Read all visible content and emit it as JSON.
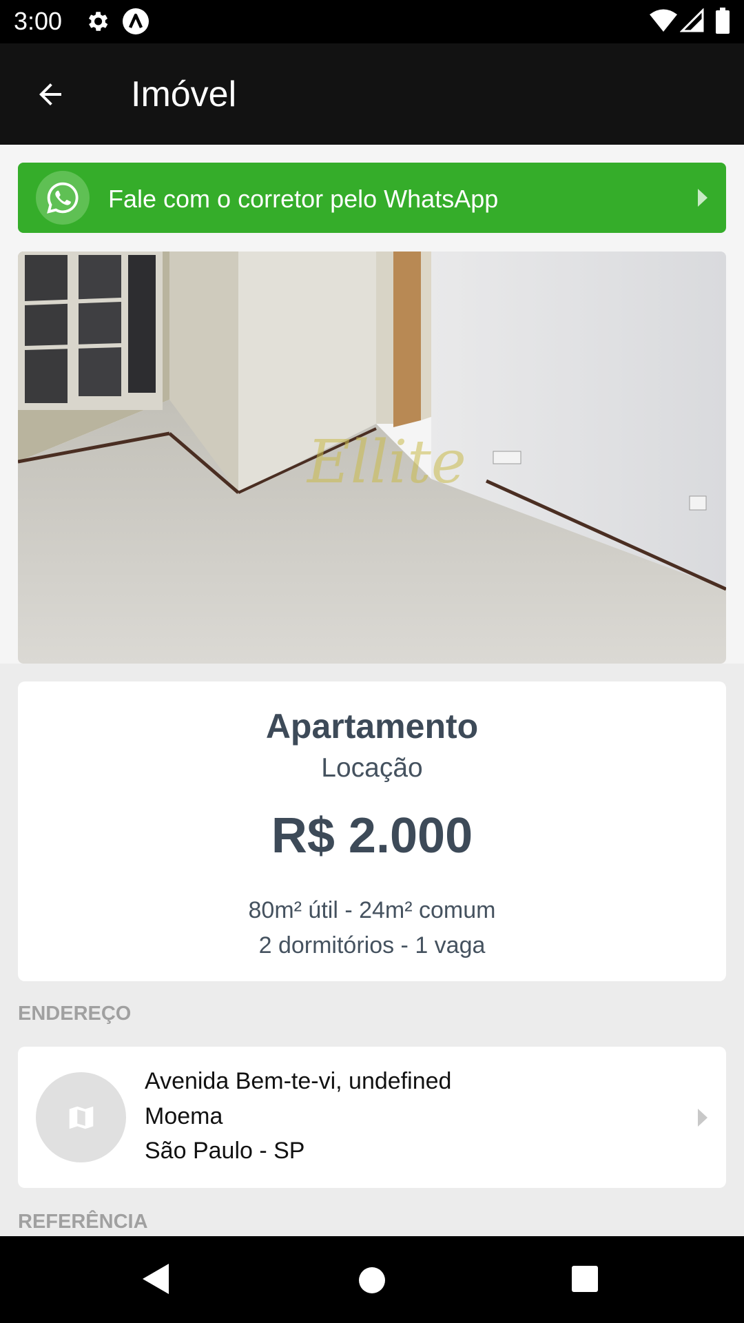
{
  "status_bar": {
    "time": "3:00",
    "icons": [
      "gear-icon",
      "app-a-icon",
      "wifi-icon",
      "signal-icon",
      "battery-icon"
    ]
  },
  "app_bar": {
    "title": "Imóvel",
    "back_icon": "arrow-back-icon"
  },
  "whatsapp": {
    "label": "Fale com o corretor pelo WhatsApp",
    "icon": "whatsapp-icon",
    "color": "#35ad2a"
  },
  "photo": {
    "watermark": "Ellite",
    "alt": "property-photo"
  },
  "property": {
    "type": "Apartamento",
    "purpose": "Locação",
    "price": "R$ 2.000",
    "area": "80m² útil - 24m² comum",
    "rooms": "2 dormitórios - 1 vaga"
  },
  "address_section": {
    "label": "ENDEREÇO",
    "line1": "Avenida Bem-te-vi, undefined",
    "line2": "Moema",
    "line3": "São Paulo - SP",
    "icon": "map-icon"
  },
  "reference_section": {
    "label": "REFERÊNCIA"
  },
  "nav_bar": {
    "icons": [
      "nav-back-icon",
      "nav-home-icon",
      "nav-recents-icon"
    ]
  },
  "colors": {
    "text_dark": "#3d4a58",
    "section_label": "#a0a0a0",
    "whatsapp_green": "#35ad2a",
    "app_bar": "#121212"
  }
}
